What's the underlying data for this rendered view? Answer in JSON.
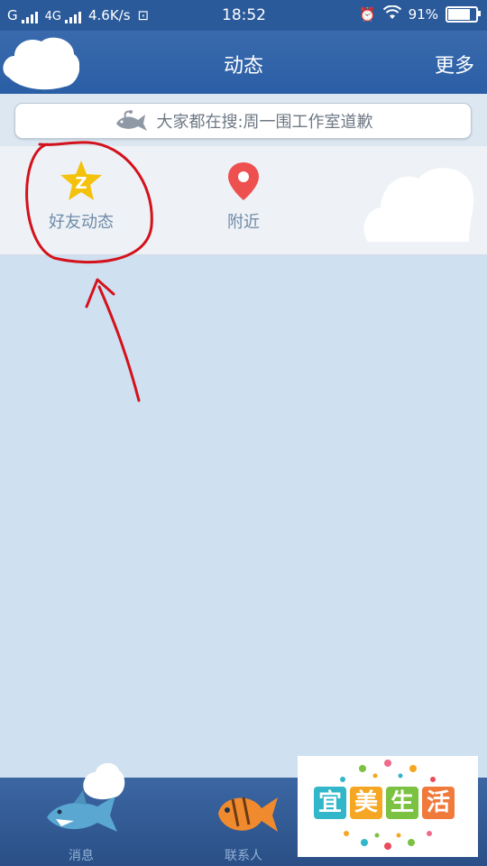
{
  "status_bar": {
    "carrier_g": "G",
    "network_4g": "4G",
    "speed": "4.6K/s",
    "time": "18:52",
    "battery": "91%",
    "battery_level": 0.91
  },
  "header": {
    "title": "动态",
    "more": "更多"
  },
  "search": {
    "text": "大家都在搜:周一围工作室道歉"
  },
  "entries": [
    {
      "label": "好友动态",
      "icon": "star-z-icon"
    },
    {
      "label": "附近",
      "icon": "location-pin-icon"
    }
  ],
  "tabbar": {
    "tabs": [
      {
        "label": "消息",
        "icon": "shark-icon"
      },
      {
        "label": "联系人",
        "icon": "fish-icon"
      }
    ]
  },
  "watermark": {
    "chars": [
      "宜",
      "美",
      "生",
      "活"
    ],
    "colors": [
      "#31b7c9",
      "#f5a623",
      "#7cc242",
      "#f07a3c"
    ]
  },
  "colors": {
    "header_bg": "#2a5ea5",
    "page_bg": "#cfe0f1",
    "annotation": "#d3121b"
  }
}
